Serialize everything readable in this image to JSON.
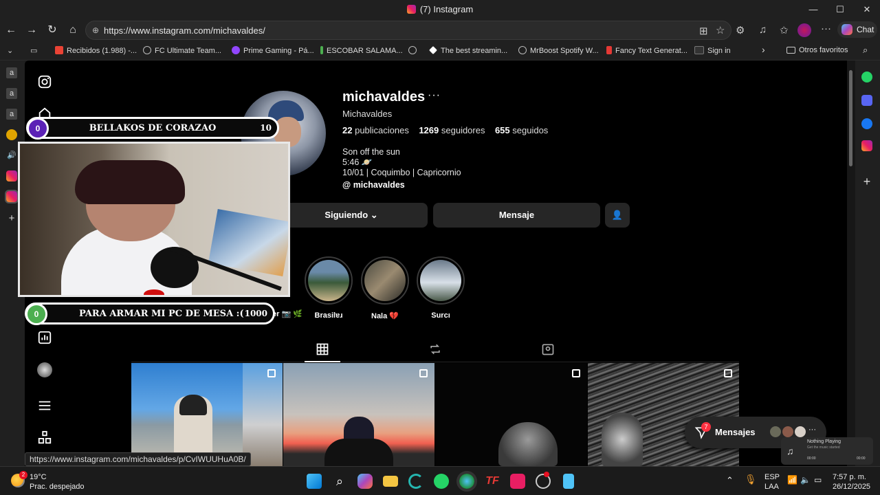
{
  "window": {
    "title": "(7) Instagram",
    "minimize": "—",
    "maximize": "☐",
    "close": "✕"
  },
  "address": {
    "url": "https://www.instagram.com/michavaldes/"
  },
  "chat_button": {
    "label": "Chat"
  },
  "bookmarks": [
    {
      "label": "Recibidos (1.988) -...",
      "icon": "gmail-icon",
      "color": "#ea4335"
    },
    {
      "label": "FC Ultimate Team...",
      "icon": "globe-icon",
      "color": "#888888"
    },
    {
      "label": "Prime Gaming - Pá...",
      "icon": "prime-gaming-icon",
      "color": "#9146ff"
    },
    {
      "label": "ESCOBAR SALAMA...",
      "icon": "leaf-icon",
      "color": "#4caf50"
    },
    {
      "label": "",
      "icon": "globe-icon",
      "color": "#888888"
    },
    {
      "label": "The best streamin...",
      "icon": "diamond-icon",
      "color": "#ffffff"
    },
    {
      "label": "MrBoost Spotify W...",
      "icon": "globe-icon",
      "color": "#888888"
    },
    {
      "label": "Fancy Text Generat...",
      "icon": "doc-icon",
      "color": "#e53935"
    },
    {
      "label": "Sign in",
      "icon": "sat-icon",
      "color": "#333333"
    }
  ],
  "bookmarks_other": "Otros favoritos",
  "profile": {
    "username": "michavaldes",
    "full_name": "Michavaldes",
    "posts_count": "22",
    "posts_label": "publicaciones",
    "followers_count": "1269",
    "followers_label": "seguidores",
    "following_count": "655",
    "following_label": "seguidos",
    "bio_lines": [
      "Son off the sun",
      "5:46 🪐",
      "10/01 | Coquimbo | Capricornio"
    ],
    "threads_handle": "michavaldes",
    "following_button": "Siguiendo",
    "message_button": "Mensaje"
  },
  "stories": [
    {
      "label": "Brasilɐɹ",
      "colors": [
        "#3a5a3a",
        "#c9b48a"
      ]
    },
    {
      "label": "Nala 💔",
      "colors": [
        "#4a4a40",
        "#9a8a70"
      ]
    },
    {
      "label": "Surcı",
      "colors": [
        "#6a7a8a",
        "#d8e0e8"
      ]
    }
  ],
  "partial_story_label": "er 📷 🌿",
  "overlay": {
    "top_goal": {
      "current": "0",
      "text": "BELLAKOS DE CORAZAO",
      "target": "10",
      "accent": "#5b21b6"
    },
    "bottom_goal": {
      "current": "0",
      "text": "PARA ARMAR MI PC DE MESA :(",
      "target": "1000",
      "accent": "#4caf50"
    }
  },
  "messages_float": {
    "label": "Mensajes",
    "badge": "7"
  },
  "now_playing": {
    "title": "Nothing Playing",
    "subtitle": "Get the music started",
    "time_start": "00:00",
    "time_end": "00:00"
  },
  "status_link": "https://www.instagram.com/michavaldes/p/CvIWUUHuA0B/",
  "taskbar": {
    "weather_temp": "19°C",
    "weather_desc": "Prac. despejado",
    "weather_badge": "2",
    "lang_line1": "ESP",
    "lang_line2": "LAA",
    "time": "7:57 p. m.",
    "date": "26/12/2025"
  }
}
